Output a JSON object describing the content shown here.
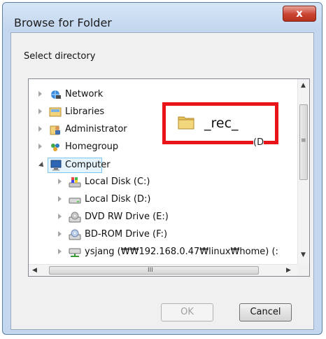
{
  "dialog": {
    "title": "Browse for Folder",
    "close_label": "x",
    "instruction": "Select directory"
  },
  "tree": {
    "items": [
      {
        "label": "Network",
        "icon": "network-icon",
        "indent": 0,
        "expander": "collapsed"
      },
      {
        "label": "Libraries",
        "icon": "libraries-icon",
        "indent": 0,
        "expander": "collapsed"
      },
      {
        "label": "Administrator",
        "icon": "user-folder-icon",
        "indent": 0,
        "expander": "collapsed"
      },
      {
        "label": "Homegroup",
        "icon": "homegroup-icon",
        "indent": 0,
        "expander": "collapsed"
      },
      {
        "label": "Computer",
        "icon": "computer-icon",
        "indent": 0,
        "expander": "expanded",
        "selected": true
      },
      {
        "label": "Local Disk (C:)",
        "icon": "system-drive-icon",
        "indent": 1,
        "expander": "collapsed"
      },
      {
        "label": "Local Disk (D:)",
        "icon": "drive-icon",
        "indent": 1,
        "expander": "collapsed"
      },
      {
        "label": "DVD RW Drive (E:)",
        "icon": "dvd-drive-icon",
        "indent": 1,
        "expander": "collapsed"
      },
      {
        "label": "BD-ROM Drive (F:)",
        "icon": "bd-drive-icon",
        "indent": 1,
        "expander": "collapsed"
      },
      {
        "label": "ysjang (₩₩192.168.0.47₩linux₩home) (:",
        "icon": "network-drive-icon",
        "indent": 1,
        "expander": "collapsed"
      }
    ]
  },
  "scrollbar": {
    "up": "▲",
    "down": "▼",
    "left": "◀",
    "right": "▶",
    "vertical_grip": "≡",
    "horizontal_grip": "III"
  },
  "overlay": {
    "label": "_rec_",
    "ghost_right": "(D",
    "accent": "#e8141a"
  },
  "buttons": {
    "ok": "OK",
    "cancel": "Cancel"
  }
}
